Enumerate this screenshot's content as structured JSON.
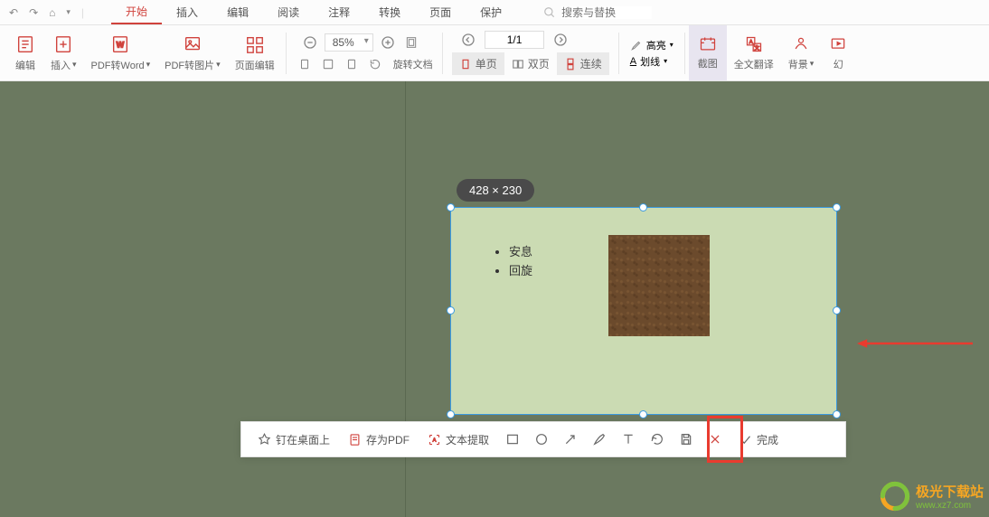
{
  "titlebar": {
    "tabs": [
      "开始",
      "插入",
      "编辑",
      "阅读",
      "注释",
      "转换",
      "页面",
      "保护"
    ],
    "active_tab": "开始",
    "search_placeholder": "搜索与替换"
  },
  "ribbon": {
    "edit": "编辑",
    "insert": "插入",
    "pdf_to_word": "PDF转Word",
    "pdf_to_img": "PDF转图片",
    "page_edit": "页面编辑",
    "zoom_value": "85%",
    "rotate": "旋转文档",
    "page_value": "1/1",
    "view_single": "单页",
    "view_double": "双页",
    "view_cont": "连续",
    "highlight": "高亮",
    "strikethrough": "划线",
    "screenshot": "截图",
    "translate": "全文翻译",
    "background": "背景",
    "slideshow_prefix": "幻"
  },
  "selection": {
    "dimensions": "428 × 230",
    "bullets": [
      "安息",
      "回旋"
    ]
  },
  "shot_bar": {
    "pin": "钉在桌面上",
    "save_pdf": "存为PDF",
    "ocr": "文本提取",
    "done": "完成"
  },
  "watermark": {
    "name": "极光下载站",
    "url": "www.xz7.com"
  }
}
